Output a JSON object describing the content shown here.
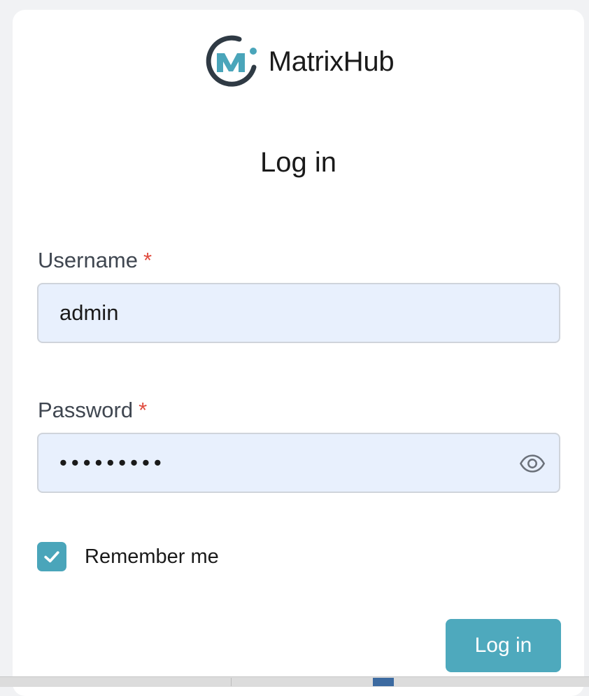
{
  "brand": {
    "name": "MatrixHub",
    "logo_icon": "matrixhub-logo-icon",
    "colors": {
      "ring": "#2f3a44",
      "accent": "#4aa5ba"
    }
  },
  "form": {
    "title": "Log in",
    "username": {
      "label": "Username",
      "required_marker": "*",
      "value": "admin"
    },
    "password": {
      "label": "Password",
      "required_marker": "*",
      "value": "•••••••••",
      "toggle_icon": "eye-icon"
    },
    "remember": {
      "label": "Remember me",
      "checked": true,
      "icon": "checkmark-icon"
    },
    "submit_label": "Log in"
  },
  "colors": {
    "input_bg": "#e8f0fd",
    "primary": "#4ea9bd",
    "required": "#e04b3e"
  }
}
